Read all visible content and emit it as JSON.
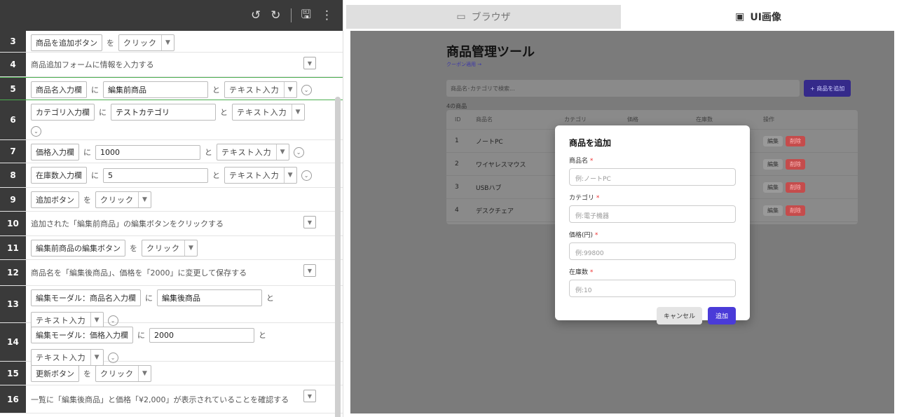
{
  "toolbar": {
    "icons": [
      "undo-icon",
      "redo-icon",
      "save-icon",
      "more-icon"
    ]
  },
  "steps": [
    {
      "n": "3",
      "parts": [
        {
          "k": "chip",
          "v": "商品を追加ボタン"
        },
        {
          "k": "txt",
          "v": "を"
        },
        {
          "k": "sel",
          "v": "クリック"
        }
      ]
    },
    {
      "n": "4",
      "parts": [
        {
          "k": "txt",
          "v": "商品追加フォームに情報を入力する"
        }
      ],
      "dd": true
    },
    {
      "n": "5",
      "parts": [
        {
          "k": "chip",
          "v": "商品名入力欄"
        },
        {
          "k": "txt",
          "v": "に"
        },
        {
          "k": "inp",
          "v": "編集前商品",
          "w": 150
        },
        {
          "k": "txt",
          "v": "と"
        },
        {
          "k": "sel",
          "v": "テキスト入力"
        },
        {
          "k": "circ"
        }
      ],
      "hl": true
    },
    {
      "n": "6",
      "parts": [
        {
          "k": "chip",
          "v": "カテゴリ入力欄"
        },
        {
          "k": "txt",
          "v": "に"
        },
        {
          "k": "inp",
          "v": "テストカテゴリ",
          "w": 150
        },
        {
          "k": "txt",
          "v": "と"
        },
        {
          "k": "sel",
          "v": "テキスト入力"
        },
        {
          "k": "br"
        },
        {
          "k": "circ"
        }
      ]
    },
    {
      "n": "7",
      "parts": [
        {
          "k": "chip",
          "v": "価格入力欄"
        },
        {
          "k": "txt",
          "v": "に"
        },
        {
          "k": "inp",
          "v": "1000",
          "w": 150
        },
        {
          "k": "txt",
          "v": "と"
        },
        {
          "k": "sel",
          "v": "テキスト入力"
        },
        {
          "k": "circ"
        }
      ]
    },
    {
      "n": "8",
      "parts": [
        {
          "k": "chip",
          "v": "在庫数入力欄"
        },
        {
          "k": "txt",
          "v": "に"
        },
        {
          "k": "inp",
          "v": "5",
          "w": 150
        },
        {
          "k": "txt",
          "v": "と"
        },
        {
          "k": "sel",
          "v": "テキスト入力"
        },
        {
          "k": "circ"
        }
      ]
    },
    {
      "n": "9",
      "parts": [
        {
          "k": "chip",
          "v": "追加ボタン"
        },
        {
          "k": "txt",
          "v": "を"
        },
        {
          "k": "sel",
          "v": "クリック"
        }
      ]
    },
    {
      "n": "10",
      "parts": [
        {
          "k": "txt",
          "v": "追加された「編集前商品」の編集ボタンをクリックする"
        }
      ],
      "dd": true
    },
    {
      "n": "11",
      "parts": [
        {
          "k": "chip",
          "v": "編集前商品の編集ボタン"
        },
        {
          "k": "txt",
          "v": "を"
        },
        {
          "k": "sel",
          "v": "クリック"
        }
      ]
    },
    {
      "n": "12",
      "parts": [
        {
          "k": "txt",
          "v": "商品名を「編集後商品」、価格を「2000」に変更して保存する"
        }
      ],
      "dd": true
    },
    {
      "n": "13",
      "parts": [
        {
          "k": "chip",
          "v": "編集モーダル：商品名入力欄"
        },
        {
          "k": "txt",
          "v": "に"
        },
        {
          "k": "inp",
          "v": "編集後商品",
          "w": 150
        },
        {
          "k": "txt",
          "v": "と"
        },
        {
          "k": "br"
        },
        {
          "k": "sel",
          "v": "テキスト入力"
        },
        {
          "k": "circ"
        }
      ]
    },
    {
      "n": "14",
      "parts": [
        {
          "k": "chip",
          "v": "編集モーダル：価格入力欄"
        },
        {
          "k": "txt",
          "v": "に"
        },
        {
          "k": "inp",
          "v": "2000",
          "w": 150
        },
        {
          "k": "txt",
          "v": "と"
        },
        {
          "k": "br"
        },
        {
          "k": "sel",
          "v": "テキスト入力"
        },
        {
          "k": "circ"
        }
      ]
    },
    {
      "n": "15",
      "parts": [
        {
          "k": "chip",
          "v": "更新ボタン"
        },
        {
          "k": "txt",
          "v": "を"
        },
        {
          "k": "sel",
          "v": "クリック"
        }
      ]
    },
    {
      "n": "16",
      "parts": [
        {
          "k": "txt",
          "v": "一覧に「編集後商品」と価格「¥2,000」が表示されていることを確認する"
        }
      ],
      "dd": true
    }
  ],
  "tabs": {
    "browser": "ブラウザ",
    "ui_image": "UI画像"
  },
  "app": {
    "title": "商品管理ツール",
    "coupon_link": "クーポン適用 →",
    "search_placeholder": "商品名･カテゴリで検索...",
    "add_button": "+ 商品を追加",
    "count": "4の商品",
    "headers": [
      "ID",
      "商品名",
      "カテゴリ",
      "価格",
      "在庫数",
      "操作"
    ],
    "rows": [
      {
        "id": "1",
        "name": "ノートPC"
      },
      {
        "id": "2",
        "name": "ワイヤレスマウス"
      },
      {
        "id": "3",
        "name": "USBハブ"
      },
      {
        "id": "4",
        "name": "デスクチェア"
      }
    ],
    "edit_label": "編集",
    "delete_label": "削除"
  },
  "modal": {
    "title": "商品を追加",
    "fields": [
      {
        "label": "商品名",
        "placeholder": "例:ノートPC"
      },
      {
        "label": "カテゴリ",
        "placeholder": "例:電子機器"
      },
      {
        "label": "価格(円)",
        "placeholder": "例:99800"
      },
      {
        "label": "在庫数",
        "placeholder": "例:10"
      }
    ],
    "required_mark": "*",
    "cancel": "キャンセル",
    "submit": "追加"
  }
}
